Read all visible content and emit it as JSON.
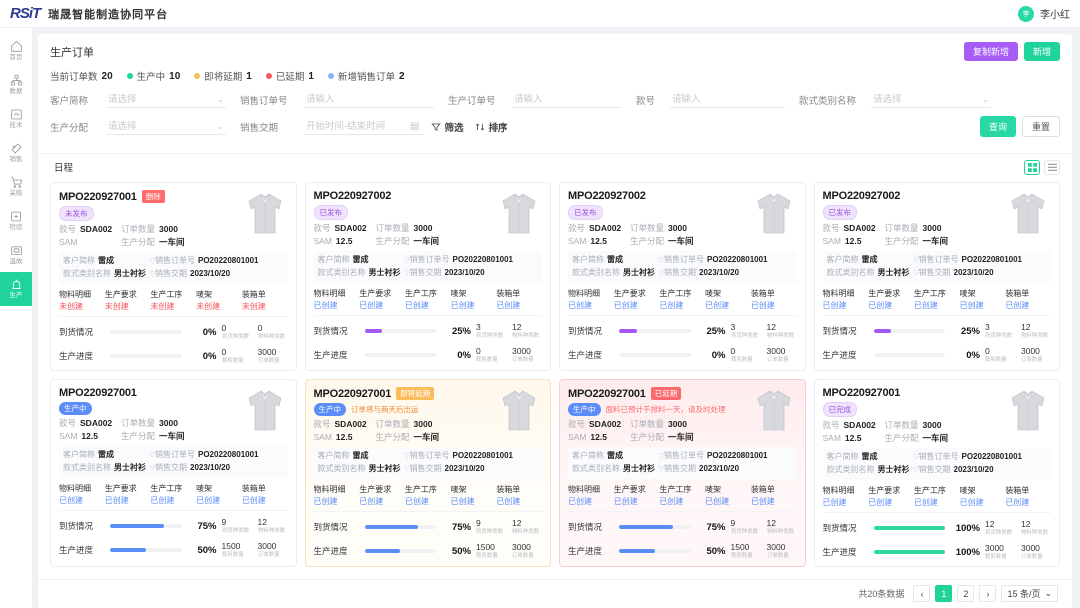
{
  "header": {
    "logo_text": "RSiT",
    "brand": "瑞晟智能制造协同平台",
    "avatar_initials": "李",
    "username": "李小红"
  },
  "sidebar": {
    "items": [
      {
        "label": "首页",
        "icon": "home-icon",
        "active": false
      },
      {
        "label": "数据",
        "icon": "data-icon",
        "active": false
      },
      {
        "label": "技术",
        "icon": "tech-icon",
        "active": false
      },
      {
        "label": "销售",
        "icon": "sales-icon",
        "active": false
      },
      {
        "label": "采购",
        "icon": "cart-icon",
        "active": false
      },
      {
        "label": "检验",
        "icon": "inspect-icon",
        "active": false
      },
      {
        "label": "温故",
        "icon": "review-icon",
        "active": false
      },
      {
        "label": "生产",
        "icon": "production-icon",
        "active": true
      }
    ]
  },
  "page": {
    "title": "生产订单",
    "copy_add_label": "复制新增",
    "add_label": "新增"
  },
  "stats": [
    {
      "label": "当前订单数",
      "value": "20",
      "color": ""
    },
    {
      "label": "生产中",
      "value": "10",
      "color": "#20d39a"
    },
    {
      "label": "即将延期",
      "value": "1",
      "color": "#fbbd5c"
    },
    {
      "label": "已延期",
      "value": "1",
      "color": "#fa5b5f"
    },
    {
      "label": "新增销售订单",
      "value": "2",
      "color": "#8ab0f7"
    }
  ],
  "filters": {
    "row1": [
      {
        "label": "客户简称",
        "placeholder": "请选择",
        "value": "",
        "type": "select"
      },
      {
        "label": "销售订单号",
        "placeholder": "请输入",
        "value": "",
        "type": "text"
      },
      {
        "label": "生产订单号",
        "placeholder": "请输入",
        "value": "",
        "type": "text"
      },
      {
        "label": "款号",
        "placeholder": "请输入",
        "value": "",
        "type": "text"
      },
      {
        "label": "款式类别名称",
        "placeholder": "请选择",
        "value": "",
        "type": "select"
      }
    ],
    "row2": [
      {
        "label": "生产分配",
        "placeholder": "请选择",
        "value": "",
        "type": "select"
      },
      {
        "label": "销售交期",
        "placeholder": "开始时间-结束时间",
        "value": "",
        "type": "date"
      }
    ],
    "filter_tool": "筛选",
    "sort_tool": "排序",
    "search_label": "查询",
    "reset_label": "重置"
  },
  "view": {
    "tab_label": "日程",
    "grid_active": true
  },
  "cards": [
    {
      "order_no": "MPO220927001",
      "corner_tag": "删除",
      "corner_tag_style": "red",
      "status_badge": "未发布",
      "status_style": "purple",
      "alert_text": "",
      "style_no_label": "款号",
      "style_no": "SDA002",
      "qty_label": "订单数量",
      "qty": "3000",
      "sam_label": "SAM",
      "sam": "",
      "assign_label": "生产分配",
      "assign": "一车间",
      "customer_label": "客户简称",
      "customer": "雷成",
      "sales_no_label": "销售订单号",
      "sales_no": "PO20220801001",
      "category_label": "款式类别名称",
      "category": "男士衬衫",
      "delivery_label": "销售交期",
      "delivery": "2023/10/20",
      "docs": [
        {
          "name": "物料明细",
          "status": "未创建",
          "created": false
        },
        {
          "name": "生产要求",
          "status": "未创建",
          "created": false
        },
        {
          "name": "生产工序",
          "status": "未创建",
          "created": false
        },
        {
          "name": "唛架",
          "status": "未创建",
          "created": false
        },
        {
          "name": "装箱单",
          "status": "未创建",
          "created": false
        }
      ],
      "arrival": {
        "label": "到货情况",
        "pct": "0%",
        "pct_num": 0,
        "bar_color": "purple",
        "n1": "0",
        "n1_label": "到货种类数",
        "n2": "0",
        "n2_label": "物料种类数"
      },
      "produce": {
        "label": "生产进度",
        "pct": "0%",
        "pct_num": 0,
        "bar_color": "blue",
        "n1": "0",
        "n1_label": "裁剪数量",
        "n2": "3000",
        "n2_label": "订单数量"
      },
      "theme": ""
    },
    {
      "order_no": "MPO220927002",
      "corner_tag": "",
      "corner_tag_style": "",
      "status_badge": "已发布",
      "status_style": "purple",
      "alert_text": "",
      "style_no_label": "款号",
      "style_no": "SDA002",
      "qty_label": "订单数量",
      "qty": "3000",
      "sam_label": "SAM",
      "sam": "12.5",
      "assign_label": "生产分配",
      "assign": "一车间",
      "customer_label": "客户简称",
      "customer": "雷成",
      "sales_no_label": "销售订单号",
      "sales_no": "PO20220801001",
      "category_label": "款式类别名称",
      "category": "男士衬衫",
      "delivery_label": "销售交期",
      "delivery": "2023/10/20",
      "docs": [
        {
          "name": "物料明细",
          "status": "已创建",
          "created": true
        },
        {
          "name": "生产要求",
          "status": "已创建",
          "created": true
        },
        {
          "name": "生产工序",
          "status": "已创建",
          "created": true
        },
        {
          "name": "唛架",
          "status": "已创建",
          "created": true
        },
        {
          "name": "装箱单",
          "status": "已创建",
          "created": true
        }
      ],
      "arrival": {
        "label": "到货情况",
        "pct": "25%",
        "pct_num": 25,
        "bar_color": "purple",
        "n1": "3",
        "n1_label": "到货种类数",
        "n2": "12",
        "n2_label": "物料种类数"
      },
      "produce": {
        "label": "生产进度",
        "pct": "0%",
        "pct_num": 0,
        "bar_color": "blue",
        "n1": "0",
        "n1_label": "裁剪数量",
        "n2": "3000",
        "n2_label": "订单数量"
      },
      "theme": ""
    },
    {
      "order_no": "MPO220927002",
      "corner_tag": "",
      "corner_tag_style": "",
      "status_badge": "已发布",
      "status_style": "purple",
      "alert_text": "",
      "style_no_label": "款号",
      "style_no": "SDA002",
      "qty_label": "订单数量",
      "qty": "3000",
      "sam_label": "SAM",
      "sam": "12.5",
      "assign_label": "生产分配",
      "assign": "一车间",
      "customer_label": "客户简称",
      "customer": "雷成",
      "sales_no_label": "销售订单号",
      "sales_no": "PO20220801001",
      "category_label": "款式类别名称",
      "category": "男士衬衫",
      "delivery_label": "销售交期",
      "delivery": "2023/10/20",
      "docs": [
        {
          "name": "物料明细",
          "status": "已创建",
          "created": true
        },
        {
          "name": "生产要求",
          "status": "已创建",
          "created": true
        },
        {
          "name": "生产工序",
          "status": "已创建",
          "created": true
        },
        {
          "name": "唛架",
          "status": "已创建",
          "created": true
        },
        {
          "name": "装箱单",
          "status": "已创建",
          "created": true
        }
      ],
      "arrival": {
        "label": "到货情况",
        "pct": "25%",
        "pct_num": 25,
        "bar_color": "purple",
        "n1": "3",
        "n1_label": "到货种类数",
        "n2": "12",
        "n2_label": "物料种类数"
      },
      "produce": {
        "label": "生产进度",
        "pct": "0%",
        "pct_num": 0,
        "bar_color": "blue",
        "n1": "0",
        "n1_label": "裁剪数量",
        "n2": "3000",
        "n2_label": "订单数量"
      },
      "theme": ""
    },
    {
      "order_no": "MPO220927002",
      "corner_tag": "",
      "corner_tag_style": "",
      "status_badge": "已发布",
      "status_style": "purple",
      "alert_text": "",
      "style_no_label": "款号",
      "style_no": "SDA002",
      "qty_label": "订单数量",
      "qty": "3000",
      "sam_label": "SAM",
      "sam": "12.5",
      "assign_label": "生产分配",
      "assign": "一车间",
      "customer_label": "客户简称",
      "customer": "雷成",
      "sales_no_label": "销售订单号",
      "sales_no": "PO20220801001",
      "category_label": "款式类别名称",
      "category": "男士衬衫",
      "delivery_label": "销售交期",
      "delivery": "2023/10/20",
      "docs": [
        {
          "name": "物料明细",
          "status": "已创建",
          "created": true
        },
        {
          "name": "生产要求",
          "status": "已创建",
          "created": true
        },
        {
          "name": "生产工序",
          "status": "已创建",
          "created": true
        },
        {
          "name": "唛架",
          "status": "已创建",
          "created": true
        },
        {
          "name": "装箱单",
          "status": "已创建",
          "created": true
        }
      ],
      "arrival": {
        "label": "到货情况",
        "pct": "25%",
        "pct_num": 25,
        "bar_color": "purple",
        "n1": "3",
        "n1_label": "到货种类数",
        "n2": "12",
        "n2_label": "物料种类数"
      },
      "produce": {
        "label": "生产进度",
        "pct": "0%",
        "pct_num": 0,
        "bar_color": "blue",
        "n1": "0",
        "n1_label": "裁剪数量",
        "n2": "3000",
        "n2_label": "订单数量"
      },
      "theme": ""
    },
    {
      "order_no": "MPO220927001",
      "corner_tag": "",
      "corner_tag_style": "",
      "status_badge": "生产中",
      "status_style": "blue",
      "alert_text": "",
      "style_no_label": "款号",
      "style_no": "SDA002",
      "qty_label": "订单数量",
      "qty": "3000",
      "sam_label": "SAM",
      "sam": "12.5",
      "assign_label": "生产分配",
      "assign": "一车间",
      "customer_label": "客户简称",
      "customer": "雷成",
      "sales_no_label": "销售订单号",
      "sales_no": "PO20220801001",
      "category_label": "款式类别名称",
      "category": "男士衬衫",
      "delivery_label": "销售交期",
      "delivery": "2023/10/20",
      "docs": [
        {
          "name": "物料明细",
          "status": "已创建",
          "created": true
        },
        {
          "name": "生产要求",
          "status": "已创建",
          "created": true
        },
        {
          "name": "生产工序",
          "status": "已创建",
          "created": true
        },
        {
          "name": "唛架",
          "status": "已创建",
          "created": true
        },
        {
          "name": "装箱单",
          "status": "已创建",
          "created": true
        }
      ],
      "arrival": {
        "label": "到货情况",
        "pct": "75%",
        "pct_num": 75,
        "bar_color": "blue",
        "n1": "9",
        "n1_label": "到货种类数",
        "n2": "12",
        "n2_label": "物料种类数"
      },
      "produce": {
        "label": "生产进度",
        "pct": "50%",
        "pct_num": 50,
        "bar_color": "blue",
        "n1": "1500",
        "n1_label": "裁剪数量",
        "n2": "3000",
        "n2_label": "订单数量"
      },
      "theme": ""
    },
    {
      "order_no": "MPO220927001",
      "corner_tag": "即将延期",
      "corner_tag_style": "orange",
      "status_badge": "生产中",
      "status_style": "blue",
      "alert_text": "订单将与两天后出运",
      "alert_style": "orange",
      "style_no_label": "款号",
      "style_no": "SDA002",
      "qty_label": "订单数量",
      "qty": "3000",
      "sam_label": "SAM",
      "sam": "12.5",
      "assign_label": "生产分配",
      "assign": "一车间",
      "customer_label": "客户简称",
      "customer": "雷成",
      "sales_no_label": "销售订单号",
      "sales_no": "PO20220801001",
      "category_label": "款式类别名称",
      "category": "男士衬衫",
      "delivery_label": "销售交期",
      "delivery": "2023/10/20",
      "docs": [
        {
          "name": "物料明细",
          "status": "已创建",
          "created": true
        },
        {
          "name": "生产要求",
          "status": "已创建",
          "created": true
        },
        {
          "name": "生产工序",
          "status": "已创建",
          "created": true
        },
        {
          "name": "唛架",
          "status": "已创建",
          "created": true
        },
        {
          "name": "装箱单",
          "status": "已创建",
          "created": true
        }
      ],
      "arrival": {
        "label": "到货情况",
        "pct": "75%",
        "pct_num": 75,
        "bar_color": "blue",
        "n1": "9",
        "n1_label": "到货种类数",
        "n2": "12",
        "n2_label": "物料种类数"
      },
      "produce": {
        "label": "生产进度",
        "pct": "50%",
        "pct_num": 50,
        "bar_color": "blue",
        "n1": "1500",
        "n1_label": "裁剪数量",
        "n2": "3000",
        "n2_label": "订单数量"
      },
      "theme": "warn"
    },
    {
      "order_no": "MPO220927001",
      "corner_tag": "已延期",
      "corner_tag_style": "redsolid",
      "status_badge": "生产中",
      "status_style": "blue",
      "alert_text": "面料已预计干排料一天，请及时处理",
      "alert_style": "red",
      "style_no_label": "款号",
      "style_no": "SDA002",
      "qty_label": "订单数量",
      "qty": "3000",
      "sam_label": "SAM",
      "sam": "12.5",
      "assign_label": "生产分配",
      "assign": "一车间",
      "customer_label": "客户简称",
      "customer": "雷成",
      "sales_no_label": "销售订单号",
      "sales_no": "PO20220801001",
      "category_label": "款式类别名称",
      "category": "男士衬衫",
      "delivery_label": "销售交期",
      "delivery": "2023/10/20",
      "docs": [
        {
          "name": "物料明细",
          "status": "已创建",
          "created": true
        },
        {
          "name": "生产要求",
          "status": "已创建",
          "created": true
        },
        {
          "name": "生产工序",
          "status": "已创建",
          "created": true
        },
        {
          "name": "唛架",
          "status": "已创建",
          "created": true
        },
        {
          "name": "装箱单",
          "status": "已创建",
          "created": true
        }
      ],
      "arrival": {
        "label": "到货情况",
        "pct": "75%",
        "pct_num": 75,
        "bar_color": "blue",
        "n1": "9",
        "n1_label": "到货种类数",
        "n2": "12",
        "n2_label": "物料种类数"
      },
      "produce": {
        "label": "生产进度",
        "pct": "50%",
        "pct_num": 50,
        "bar_color": "blue",
        "n1": "1500",
        "n1_label": "裁剪数量",
        "n2": "3000",
        "n2_label": "订单数量"
      },
      "theme": "late"
    },
    {
      "order_no": "MPO220927001",
      "corner_tag": "",
      "corner_tag_style": "",
      "status_badge": "已完成",
      "status_style": "purple",
      "alert_text": "",
      "style_no_label": "款号",
      "style_no": "SDA002",
      "qty_label": "订单数量",
      "qty": "3000",
      "sam_label": "SAM",
      "sam": "12.5",
      "assign_label": "生产分配",
      "assign": "一车间",
      "customer_label": "客户简称",
      "customer": "雷成",
      "sales_no_label": "销售订单号",
      "sales_no": "PO20220801001",
      "category_label": "款式类别名称",
      "category": "男士衬衫",
      "delivery_label": "销售交期",
      "delivery": "2023/10/20",
      "docs": [
        {
          "name": "物料明细",
          "status": "已创建",
          "created": true
        },
        {
          "name": "生产要求",
          "status": "已创建",
          "created": true
        },
        {
          "name": "生产工序",
          "status": "已创建",
          "created": true
        },
        {
          "name": "唛架",
          "status": "已创建",
          "created": true
        },
        {
          "name": "装箱单",
          "status": "已创建",
          "created": true
        }
      ],
      "arrival": {
        "label": "到货情况",
        "pct": "100%",
        "pct_num": 100,
        "bar_color": "green",
        "n1": "12",
        "n1_label": "到货种类数",
        "n2": "12",
        "n2_label": "物料种类数"
      },
      "produce": {
        "label": "生产进度",
        "pct": "100%",
        "pct_num": 100,
        "bar_color": "green",
        "n1": "3000",
        "n1_label": "裁剪数量",
        "n2": "3000",
        "n2_label": "订单数量"
      },
      "theme": ""
    }
  ],
  "pagination": {
    "total_text": "共20条数据",
    "prev": "‹",
    "next": "›",
    "pages": [
      "1",
      "2"
    ],
    "active_page": "1",
    "page_size": "15 条/页"
  }
}
